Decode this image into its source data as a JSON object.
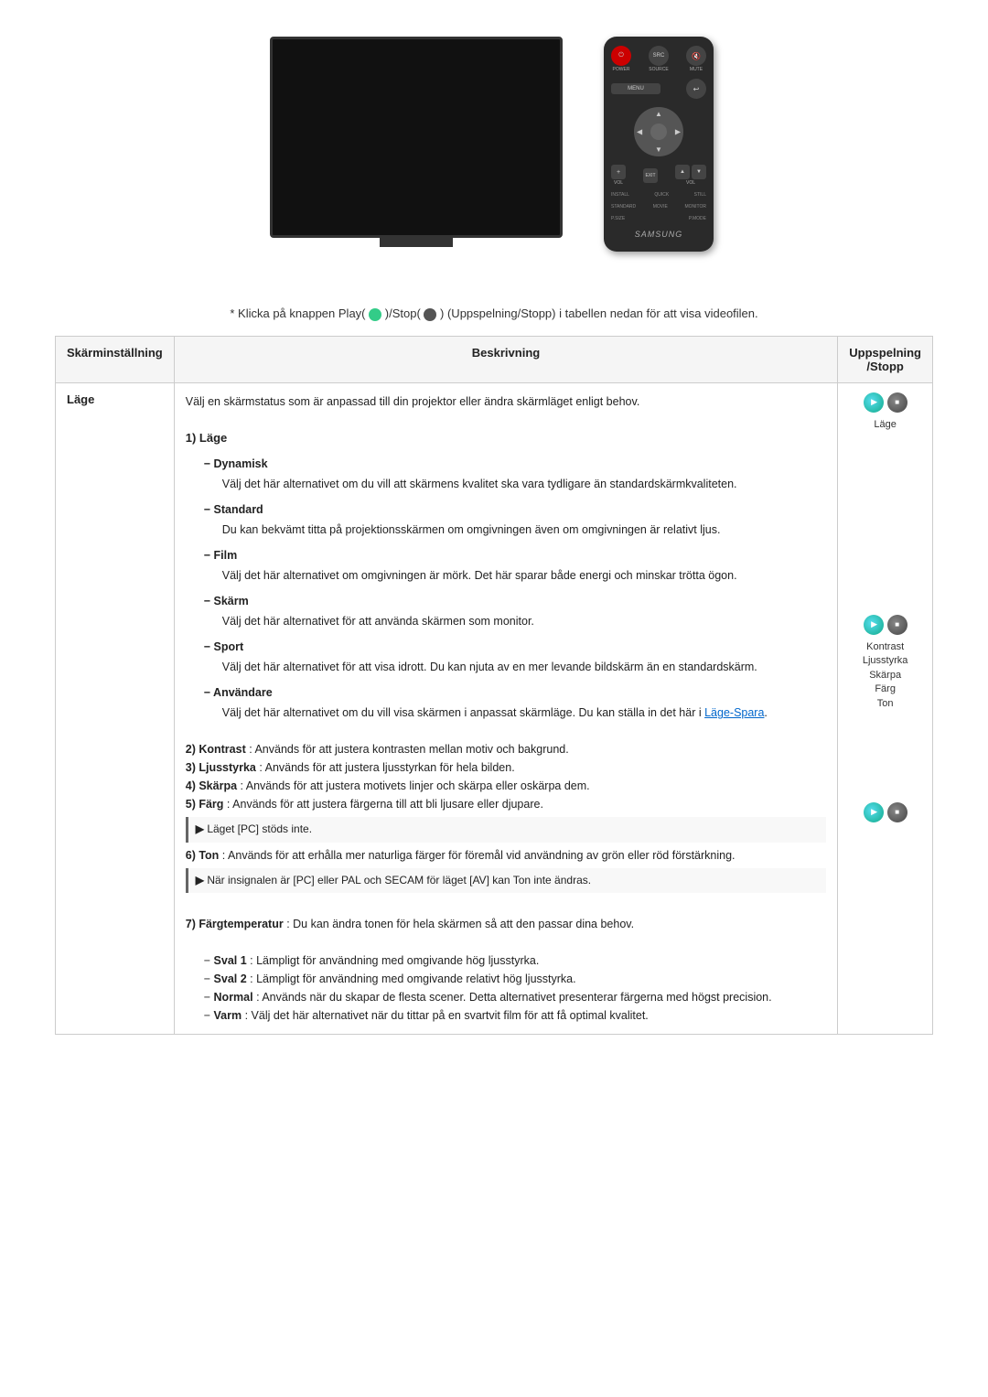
{
  "page": {
    "instruction": "* Klicka på knappen Play(",
    "instruction_mid": ")/Stop(",
    "instruction_end": ") (Uppspelning/Stopp) i tabellen nedan för att visa videofilen.",
    "table": {
      "headers": {
        "setting": "Skärminställning",
        "description": "Beskrivning",
        "playback": "Uppspelning\n/Stopp"
      },
      "rows": [
        {
          "setting": "Läge",
          "description_intro": "Välj en skärmstatus som är anpassad till din projektor eller ändra skärmläget enligt behov.",
          "sections": [
            {
              "title": "1) Läge",
              "items": [
                {
                  "name": "Dynamisk",
                  "text": "Välj det här alternativet om du vill att skärmens kvalitet ska vara tydligare än standardskärmkvaliteten."
                },
                {
                  "name": "Standard",
                  "text": "Du kan bekvämt titta på projektionsskärmen om omgivningen även om omgivningen är relativt ljus."
                },
                {
                  "name": "Film",
                  "text": "Välj det här alternativet om omgivningen är mörk. Det här sparar både energi och minskar trötta ögon."
                },
                {
                  "name": "Skärm",
                  "text": "Välj det här alternativet för att använda skärmen som monitor."
                },
                {
                  "name": "Sport",
                  "text": "Välj det här alternativet för att visa idrott. Du kan njuta av en mer levande bildskärm än en standardskärm."
                },
                {
                  "name": "Användare",
                  "text": "Välj det här alternativet om du vill visa skärmen i anpassat skärmläge. Du kan ställa in det här i ",
                  "link": "Läge-Spara",
                  "text_after": "."
                }
              ]
            },
            {
              "numbered_items": [
                {
                  "number": "2)",
                  "label": "Kontrast",
                  "text": ": Används för att justera kontrasten mellan motiv och bakgrund."
                },
                {
                  "number": "3)",
                  "label": "Ljusstyrka",
                  "text": ": Används för att justera ljusstyrkan för hela bilden."
                },
                {
                  "number": "4)",
                  "label": "Skärpa",
                  "text": ": Används för att justera motivets linjer och skärpa eller oskärpa dem."
                },
                {
                  "number": "5)",
                  "label": "Färg",
                  "text": ": Används för att justera färgerna till att bli ljusare eller djupare."
                }
              ],
              "note1": "▶ Läget [PC] stöds inte.",
              "numbered_items2": [
                {
                  "number": "6)",
                  "label": "Ton",
                  "text": ": Används för att erhålla mer naturliga färger för föremål vid användning av grön eller röd förstärkning."
                }
              ],
              "note2": "▶ När insignalen är [PC] eller PAL och SECAM för läget [AV] kan Ton inte ändras."
            },
            {
              "title": "7) Färgtemperatur",
              "title_text": ": Du kan ändra tonen för hela skärmen så att den passar dina behov.",
              "sub_items": [
                {
                  "name": "Sval 1",
                  "text": ": Lämpligt för användning med omgivande hög ljusstyrka."
                },
                {
                  "name": "Sval 2",
                  "text": ": Lämpligt för användning med omgivande relativt hög ljusstyrka."
                },
                {
                  "name": "Normal",
                  "text": ": Används när du skapar de flesta scener. Detta alternativet presenterar färgerna med högst precision."
                },
                {
                  "name": "Varm",
                  "text": ": Välj det här alternativet när du tittar på en svartvit film för att få optimal kvalitet."
                }
              ]
            }
          ],
          "playback_labels": [
            "Läge",
            "Kontrast",
            "Ljusstyrka",
            "Skärpa",
            "Färg",
            "Ton"
          ]
        }
      ]
    }
  }
}
